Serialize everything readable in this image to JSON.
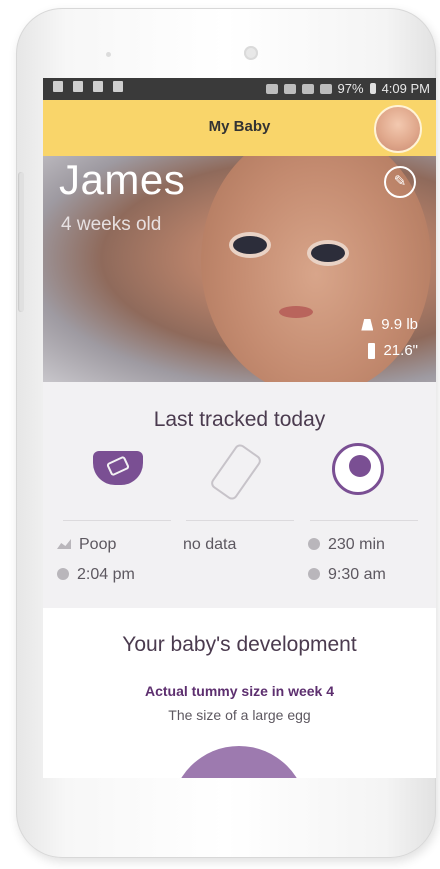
{
  "status_bar": {
    "battery": "97%",
    "time": "4:09 PM"
  },
  "app_bar": {
    "title": "My Baby"
  },
  "profile": {
    "name": "James",
    "age": "4 weeks old",
    "weight": "9.9 lb",
    "length": "21.6\""
  },
  "tracking": {
    "heading": "Last tracked today",
    "diaper": {
      "type": "Poop",
      "time": "2:04 pm"
    },
    "feeding": {
      "status": "no data"
    },
    "sleep": {
      "duration": "230 min",
      "time": "9:30 am"
    }
  },
  "development": {
    "heading": "Your baby's development",
    "subtitle": "Actual tummy size in week 4",
    "description": "The size of a large egg"
  },
  "colors": {
    "app_bar": "#f9d56a",
    "accent_purple": "#7a4f93",
    "egg": "#9d7aaf"
  },
  "icons": [
    "diaper-icon",
    "bottle-icon",
    "moon-icon",
    "edit-icon",
    "weight-icon",
    "length-icon",
    "clock-icon"
  ]
}
